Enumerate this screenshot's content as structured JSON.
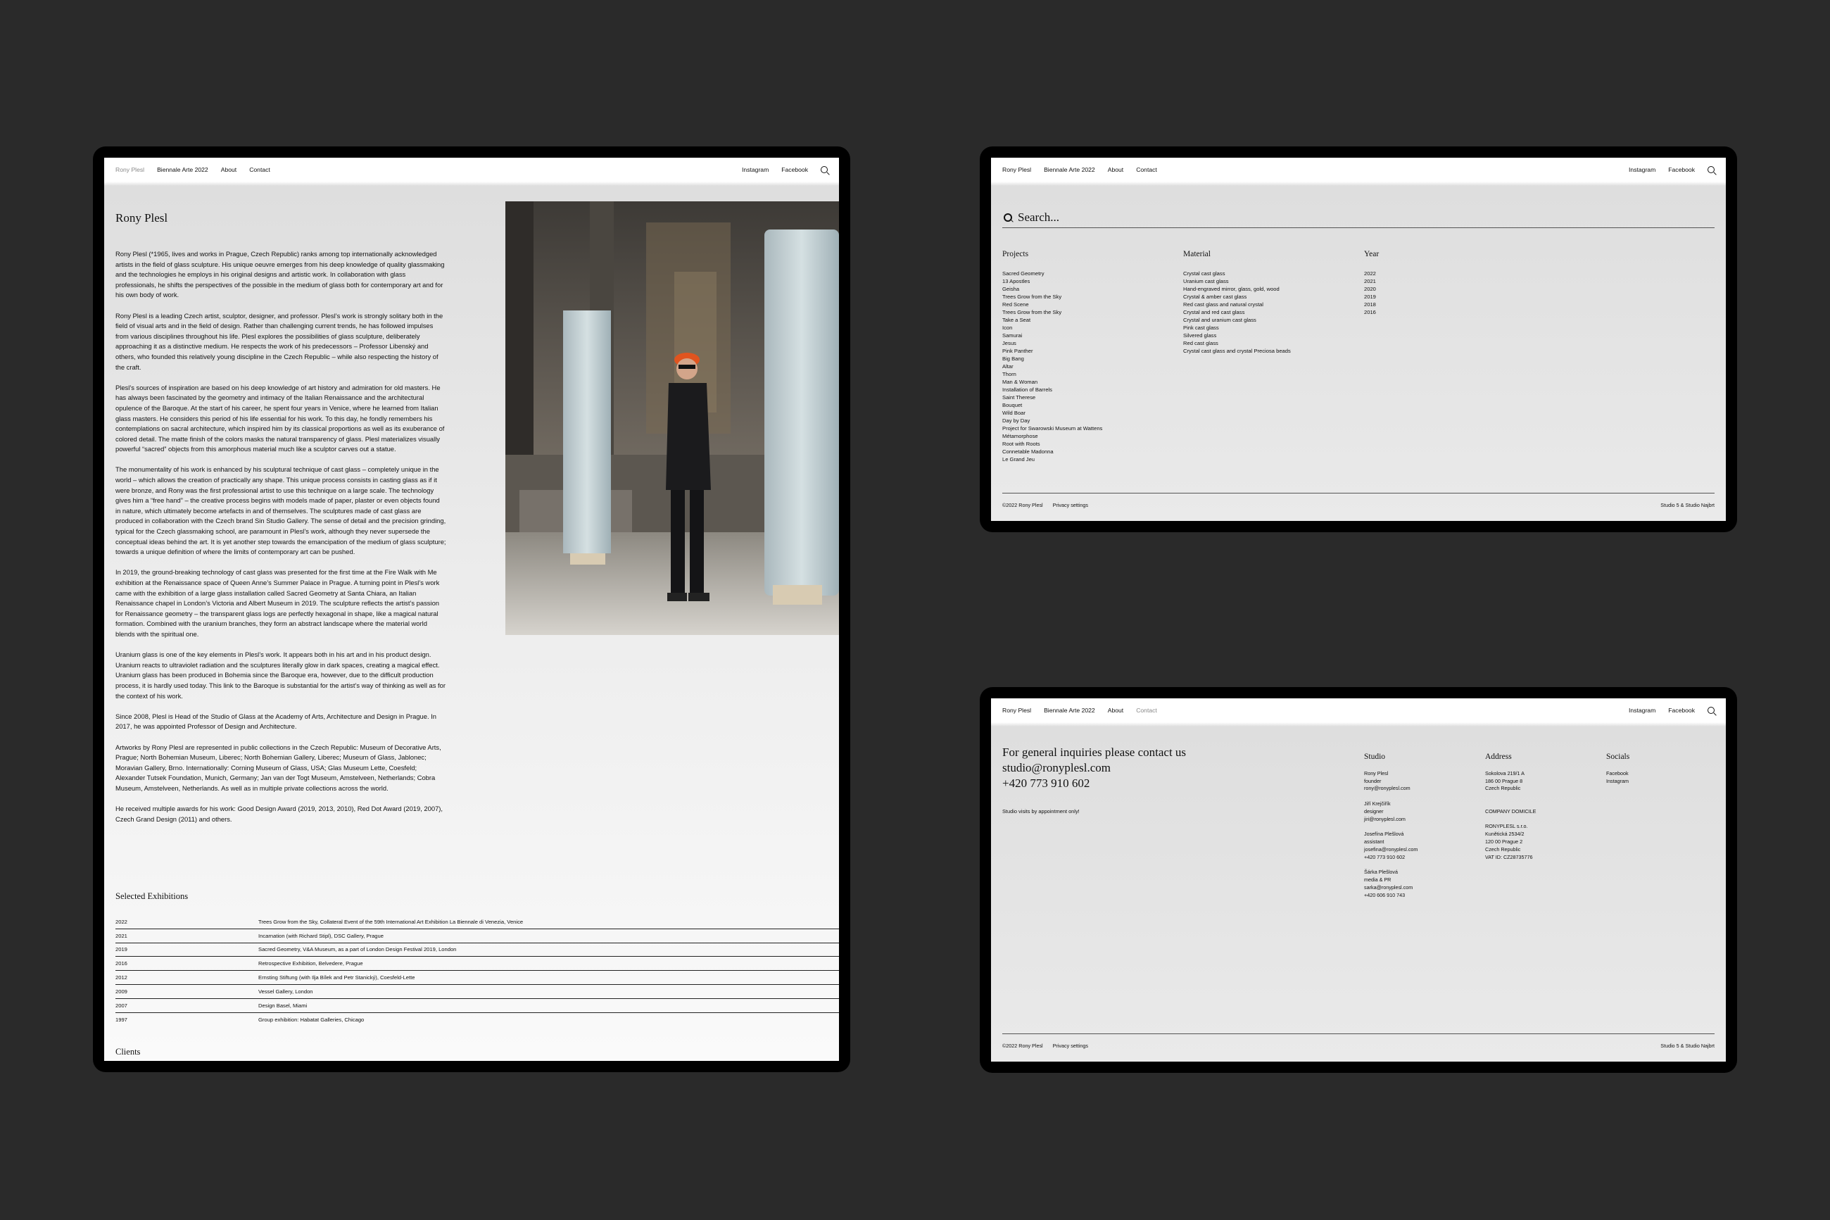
{
  "nav": {
    "brand": "Rony Plesl",
    "biennale": "Biennale Arte 2022",
    "about": "About",
    "contact": "Contact",
    "instagram": "Instagram",
    "facebook": "Facebook",
    "search_icon": "search-icon"
  },
  "about": {
    "title": "Rony Plesl",
    "paragraphs": [
      "Rony Plesl (*1965, lives and works in Prague, Czech Republic) ranks among top internationally acknowledged artists in the field of glass sculpture. His unique oeuvre emerges from his deep knowledge of quality glassmaking and the technologies he employs in his original designs and artistic work. In collaboration with glass professionals, he shifts the perspectives of the possible in the medium of glass both for contemporary art and for his own body of work.",
      "Rony Plesl is a leading Czech artist, sculptor, designer, and professor. Plesl’s work is strongly solitary both in the field of visual arts and in the field of design. Rather than challenging current trends, he has followed impulses from various disciplines throughout his life. Plesl explores the possibilities of glass sculpture, deliberately approaching it as a distinctive medium. He respects the work of his predecessors – Professor Libenský and others, who founded this relatively young discipline in the Czech Republic – while also respecting the history of the craft.",
      "Plesl’s sources of inspiration are based on his deep knowledge of art history and admiration for old masters. He has always been fascinated by the geometry and intimacy of the Italian Renaissance and the architectural opulence of the Baroque. At the start of his career, he spent four years in Venice, where he learned from Italian glass masters. He considers this period of his life essential for his work. To this day, he fondly remembers his contemplations on sacral architecture, which inspired him by its classical proportions as well as its exuberance of colored detail. The matte finish of the colors masks the natural transparency of glass. Plesl materializes visually powerful “sacred” objects from this amorphous material much like a sculptor carves out a statue.",
      "The monumentality of his work is enhanced by his sculptural technique of cast glass – completely unique in the world – which allows the creation of practically any shape. This unique process consists in casting glass as if it were bronze, and Rony was the first professional artist to use this technique on a large scale. The technology gives him a “free hand” – the creative process begins with models made of paper, plaster or even objects found in nature, which ultimately become artefacts in and of themselves. The sculptures made of cast glass are produced in collaboration with the Czech brand Sin Studio Gallery. The sense of detail and the precision grinding, typical for the Czech glassmaking school, are paramount in Plesl’s work, although they never supersede the conceptual ideas behind the art. It is yet another step towards the emancipation of the medium of glass sculpture; towards a unique definition of where the limits of contemporary art can be pushed.",
      "In 2019, the ground-breaking technology of cast glass was presented for the first time at the Fire Walk with Me exhibition at the Renaissance space of Queen Anne’s Summer Palace in Prague. A turning point in Plesl’s work came with the exhibition of a large glass installation called Sacred Geometry at Santa Chiara, an Italian Renaissance chapel in London’s Victoria and Albert Museum in 2019. The sculpture reflects the artist’s passion for Renaissance geometry – the transparent glass logs are perfectly hexagonal in shape, like a magical natural formation. Combined with the uranium branches, they form an abstract landscape where the material world blends with the spiritual one.",
      "Uranium glass is one of the key elements in Plesl’s work. It appears both in his art and in his product design. Uranium reacts to ultraviolet radiation and the sculptures literally glow in dark spaces, creating a magical effect. Uranium glass has been produced in Bohemia since the Baroque era, however, due to the difficult production process, it is hardly used today. This link to the Baroque is substantial for the artist’s way of thinking as well as for the context of his work.",
      "Since 2008, Plesl is Head of the Studio of Glass at the Academy of Arts, Architecture and Design in Prague. In 2017, he was appointed Professor of Design and Architecture.",
      "Artworks by Rony Plesl are represented in public collections in the Czech Republic: Museum of Decorative Arts, Prague; North Bohemian Museum, Liberec; North Bohemian Gallery, Liberec; Museum of Glass, Jablonec; Moravian Gallery, Brno. Internationally: Corning Museum of Glass, USA; Glas Museum Lette, Coesfeld; Alexander Tutsek Foundation, Munich, Germany; Jan van der Togt Museum, Amstelveen, Netherlands; Cobra Museum, Amstelveen, Netherlands. As well as in multiple private collections across the world.",
      "He received multiple awards for his work: Good Design Award (2019, 2013, 2010), Red Dot Award (2019, 2007), Czech Grand Design (2011) and others."
    ],
    "exhibitions_title": "Selected Exhibitions",
    "exhibitions": [
      {
        "year": "2022",
        "text": "Trees Grow from the Sky, Collateral Event of the 59th International Art Exhibition La Biennale di Venezia, Venice"
      },
      {
        "year": "2021",
        "text": "Incarnation (with Richard Stipl), DSC Gallery, Prague"
      },
      {
        "year": "2019",
        "text": "Sacred Geometry, V&A Museum, as a part of London Design Festival 2019, London"
      },
      {
        "year": "2016",
        "text": "Retrospective Exhibition, Belvedere, Prague"
      },
      {
        "year": "2012",
        "text": "Ernsting Stiftung (with Ilja Bílek and Petr Stanický), Coesfeld-Lette"
      },
      {
        "year": "2009",
        "text": "Vessel Gallery, London"
      },
      {
        "year": "2007",
        "text": "Design Basel, Miami"
      },
      {
        "year": "1997",
        "text": "Group exhibition: Habatat Galleries, Chicago"
      }
    ],
    "clients_title": "Clients"
  },
  "search": {
    "placeholder": "Search...",
    "projects_title": "Projects",
    "material_title": "Material",
    "year_title": "Year",
    "projects": [
      "Sacred Geometry",
      "13 Apostles",
      "Geisha",
      "Trees Grow from the Sky",
      "Red Scene",
      "Trees Grow from the Sky",
      "Take a Seat",
      "Icon",
      "Samurai",
      "Jesus",
      "Pink Panther",
      "Big Bang",
      "Altar",
      "Thorn",
      "Man & Woman",
      "Installation of Barrels",
      "Saint Therese",
      "Bouquet",
      "Wild Boar",
      "Day by Day",
      "Project for Swarowski Museum at Wattens",
      "Métamorphose",
      "Root with Roots",
      "Connetable Madonna",
      "Le Grand Jeu"
    ],
    "materials": [
      "Crystal cast glass",
      "Uranium cast glass",
      "Hand-engraved mirror, glass, gold, wood",
      "Crystal & amber cast glass",
      "Red cast glass and natural crystal",
      "Crystal and red cast glass",
      "Crystal and uranium cast glass",
      "Pink cast glass",
      "Silvered glass",
      "Red cast glass",
      "Crystal cast glass and crystal Preciosa beads"
    ],
    "years": [
      "2022",
      "2021",
      "2020",
      "2019",
      "2018",
      "2016"
    ]
  },
  "footer": {
    "copyright": "©2022 Rony Plesl",
    "privacy": "Privacy settings",
    "credits": "Studio 5 & Studio Najbrt"
  },
  "contact": {
    "heading": "For general inquiries please contact us",
    "email": "studio@ronyplesl.com",
    "phone": "+420 773 910 602",
    "note": "Studio visits by appointment only!",
    "studio_title": "Studio",
    "address_title": "Address",
    "socials_title": "Socials",
    "people": [
      [
        "Rony Plesl",
        "founder",
        "rony@ronyplesl.com"
      ],
      [
        "Jiří Krejčiřík",
        "designer",
        "jiri@ronyplesl.com"
      ],
      [
        "Josefína Plešlová",
        "assistant",
        "josefina@ronyplesl.com",
        "+420 773 910 602"
      ],
      [
        "Šárka Plešlová",
        "media & PR",
        "sarka@ronyplesl.com",
        "+420 606 910 743"
      ]
    ],
    "address": [
      "Sokolova 219/1 A",
      "186 00 Prague 8",
      "Czech Republic"
    ],
    "domicile_title": "COMPANY DOMICILE",
    "domicile": [
      "RONYPLESL s.r.o.",
      "Kunětická 2534/2",
      "120 00 Prague 2",
      "Czech Republic",
      "VAT ID: CZ28735776"
    ],
    "socials": [
      "Facebook",
      "Instagram"
    ]
  },
  "colors": {
    "background": "#2a2a2a",
    "device": "#000000",
    "text": "#111111"
  }
}
